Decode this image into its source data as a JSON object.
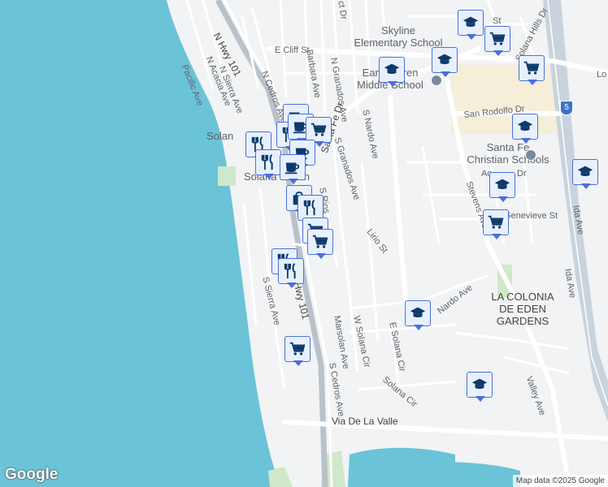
{
  "map": {
    "water_color": "#6bc3d8",
    "land_color": "#f1f3f4",
    "road_color": "#ffffff",
    "freeway_color": "#c9d3dd",
    "park_color": "#cfe8c9",
    "school_area_color": "#f5efd9"
  },
  "labels": {
    "n_hwy_101": "N Hwy 101",
    "pacific_ave": "Pacific Ave",
    "n_acacia_ave": "N Acacia Ave",
    "n_sierra_ave": "N Sierra Ave",
    "n_cedros_ave": "N Cedros Ave",
    "barbara_ave": "Barbara Ave",
    "n_granados_ave": "N Granados Ave",
    "e_cliff_st": "E Cliff St",
    "skyline_school_line1": "Skyline",
    "skyline_school_line2": "Elementary School",
    "earl_warren_line1": "Earl Warren",
    "earl_warren_line2": "Middle School",
    "santa_fe_dr": "Santa Fe Dr",
    "s_granados_ave": "S Granados Ave",
    "s_nardo_ave": "S Nardo Ave",
    "solana_beach_a": "Solan",
    "solana_beach_b": "Solana Beach",
    "san_rodolfo_dr": "San Rodolfo Dr",
    "santa_fe_christian_line1": "Santa Fe",
    "santa_fe_christian_line2": "Christian Schools",
    "stevens_ave": "Stevens Ave",
    "genevieve_st": "Genevieve St",
    "lirio_st": "Lirio St",
    "ida_ave": "Ida Ave",
    "la_colonia_line1": "LA COLONIA",
    "la_colonia_line2": "DE EDEN",
    "la_colonia_line3": "GARDENS",
    "s_sierra_ave": "S Sierra Ave",
    "hwy_101": "Hwy 101",
    "marsolan_ave": "Marsolan Ave",
    "w_solana_cir": "W Solana Cir",
    "e_solana_cir": "E Solana Cir",
    "solana_cir": "Solana Cir",
    "s_cedros_ave": "S Cedros Ave",
    "via_de_la_valle": "Via De La Valle",
    "valley_ave": "Valley Ave",
    "nardo_ave": "Nardo Ave",
    "solana_hills_dr": "Solana Hills Dr",
    "lo_partial": "Lo",
    "st_partial": "St",
    "dr_partial": "Dr",
    "ac_partial": "Ac",
    "cr_partial": "ct Dr",
    "s_rios": "S Rios",
    "interstate_5": "5"
  },
  "pins": [
    {
      "type": "school",
      "icon": "graduation-cap-icon"
    },
    {
      "type": "grocery",
      "icon": "shopping-cart-icon"
    },
    {
      "type": "school",
      "icon": "graduation-cap-icon"
    },
    {
      "type": "school",
      "icon": "graduation-cap-icon"
    },
    {
      "type": "grocery",
      "icon": "shopping-cart-icon"
    },
    {
      "type": "school",
      "icon": "graduation-cap-icon"
    },
    {
      "type": "school",
      "icon": "graduation-cap-icon"
    },
    {
      "type": "school",
      "icon": "graduation-cap-icon"
    },
    {
      "type": "grocery",
      "icon": "shopping-cart-icon"
    },
    {
      "type": "cafe",
      "icon": "coffee-cup-icon"
    },
    {
      "type": "restaurant",
      "icon": "fork-knife-icon"
    },
    {
      "type": "cafe",
      "icon": "coffee-cup-icon"
    },
    {
      "type": "grocery",
      "icon": "shopping-cart-icon"
    },
    {
      "type": "restaurant",
      "icon": "fork-knife-icon"
    },
    {
      "type": "cafe",
      "icon": "coffee-cup-icon"
    },
    {
      "type": "restaurant",
      "icon": "fork-knife-icon"
    },
    {
      "type": "cafe",
      "icon": "coffee-cup-icon"
    },
    {
      "type": "shopping",
      "icon": "shopping-bag-icon"
    },
    {
      "type": "restaurant",
      "icon": "fork-knife-icon"
    },
    {
      "type": "grocery",
      "icon": "shopping-cart-icon"
    },
    {
      "type": "grocery",
      "icon": "shopping-cart-icon"
    },
    {
      "type": "restaurant",
      "icon": "fork-knife-icon"
    },
    {
      "type": "restaurant",
      "icon": "fork-knife-icon"
    },
    {
      "type": "grocery",
      "icon": "shopping-cart-icon"
    },
    {
      "type": "school",
      "icon": "graduation-cap-icon"
    },
    {
      "type": "school",
      "icon": "graduation-cap-icon"
    }
  ],
  "branding": {
    "google": "Google",
    "attribution": "Map data ©2025 Google"
  }
}
